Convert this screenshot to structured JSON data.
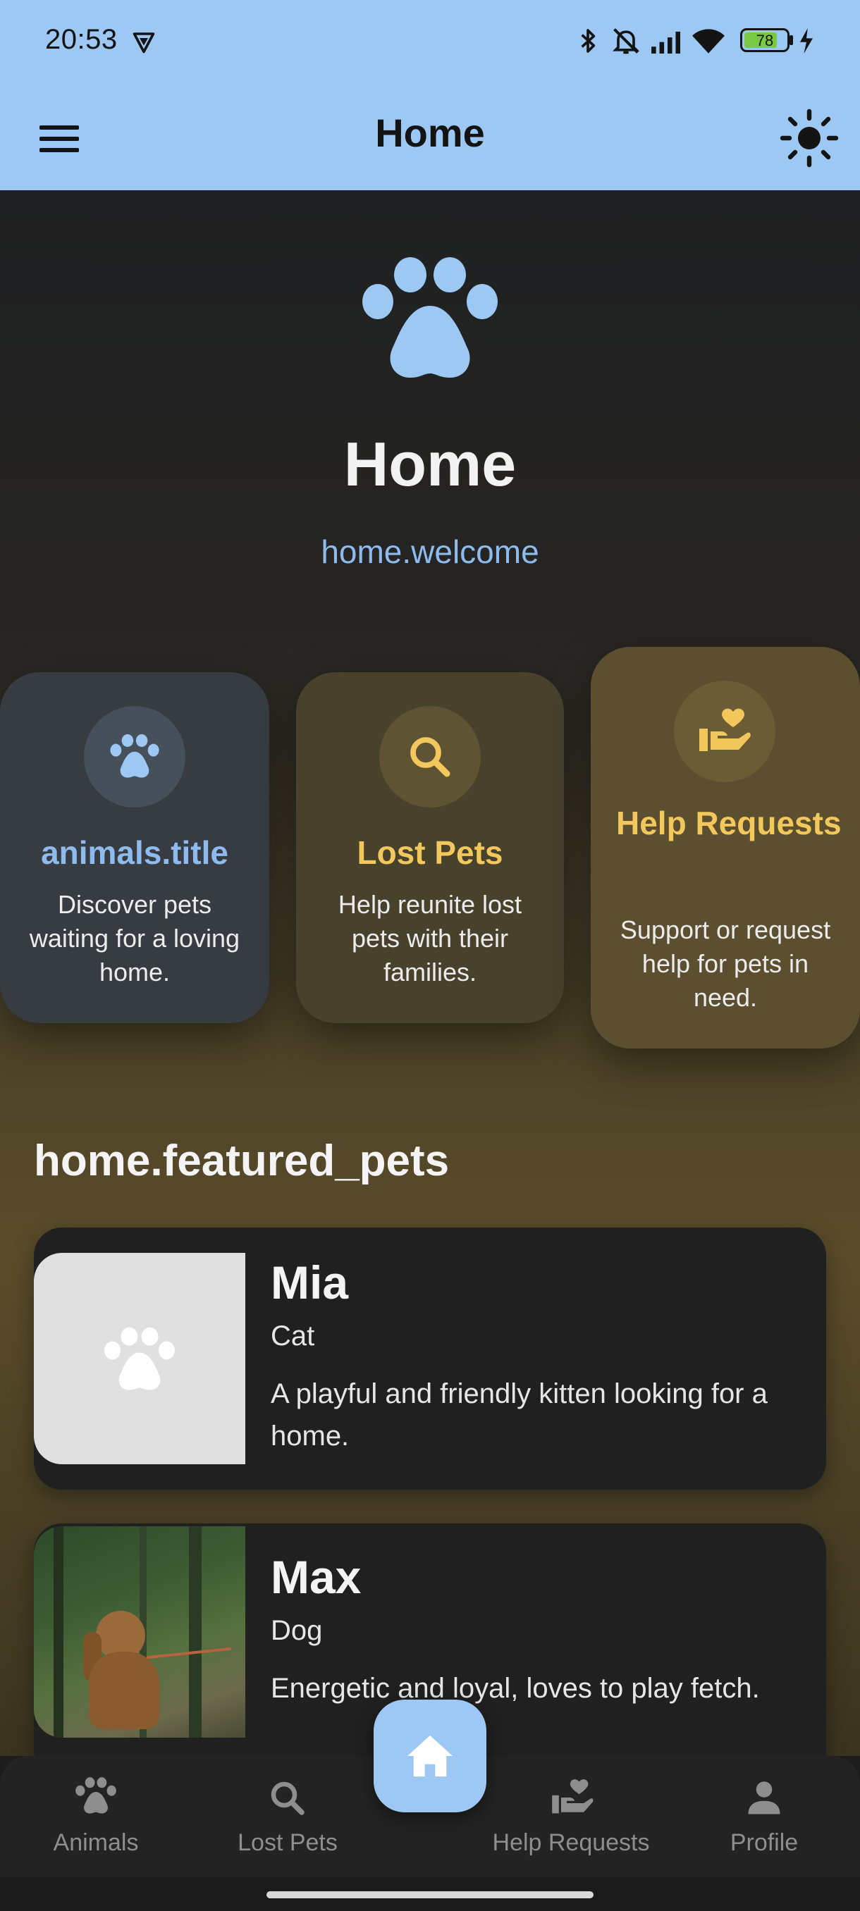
{
  "status_bar": {
    "time": "20:53",
    "battery": "78",
    "icons": [
      "shield-app-icon",
      "bluetooth-icon",
      "bell-muted-icon",
      "signal-icon",
      "wifi-icon",
      "battery-icon",
      "charging-icon"
    ]
  },
  "app_bar": {
    "title": "Home",
    "menu_icon": "hamburger-menu-icon",
    "theme_icon": "sun-icon"
  },
  "hero": {
    "icon": "paw-icon",
    "title": "Home",
    "subtitle": "home.welcome"
  },
  "feature_cards": [
    {
      "title": "animals.title",
      "description": "Discover pets waiting for a loving home.",
      "icon": "paw-icon",
      "accent": "#8ebbed"
    },
    {
      "title": "Lost Pets",
      "description": "Help reunite lost pets with their families.",
      "icon": "search-icon",
      "accent": "#f2c75c"
    },
    {
      "title": "Help Requests",
      "description": "Support or request help for pets in need.",
      "icon": "hand-heart-icon",
      "accent": "#f2c75c"
    }
  ],
  "featured": {
    "section_title": "home.featured_pets",
    "pets": [
      {
        "name": "Mia",
        "type": "Cat",
        "description": "A playful and friendly kitten looking for a home.",
        "image": "paw-placeholder-icon"
      },
      {
        "name": "Max",
        "type": "Dog",
        "description": "Energetic and loyal, loves to play fetch.",
        "image": "dog-photo"
      }
    ]
  },
  "bottom_nav": {
    "items": [
      {
        "label": "Animals",
        "icon": "paw-icon"
      },
      {
        "label": "Lost Pets",
        "icon": "search-icon"
      },
      {
        "label": "Help Requests",
        "icon": "hand-heart-icon"
      },
      {
        "label": "Profile",
        "icon": "person-icon"
      }
    ],
    "fab_icon": "home-icon"
  },
  "colors": {
    "primary": "#9cc8f3",
    "accent_gold": "#f2c75c",
    "surface": "#202020"
  }
}
